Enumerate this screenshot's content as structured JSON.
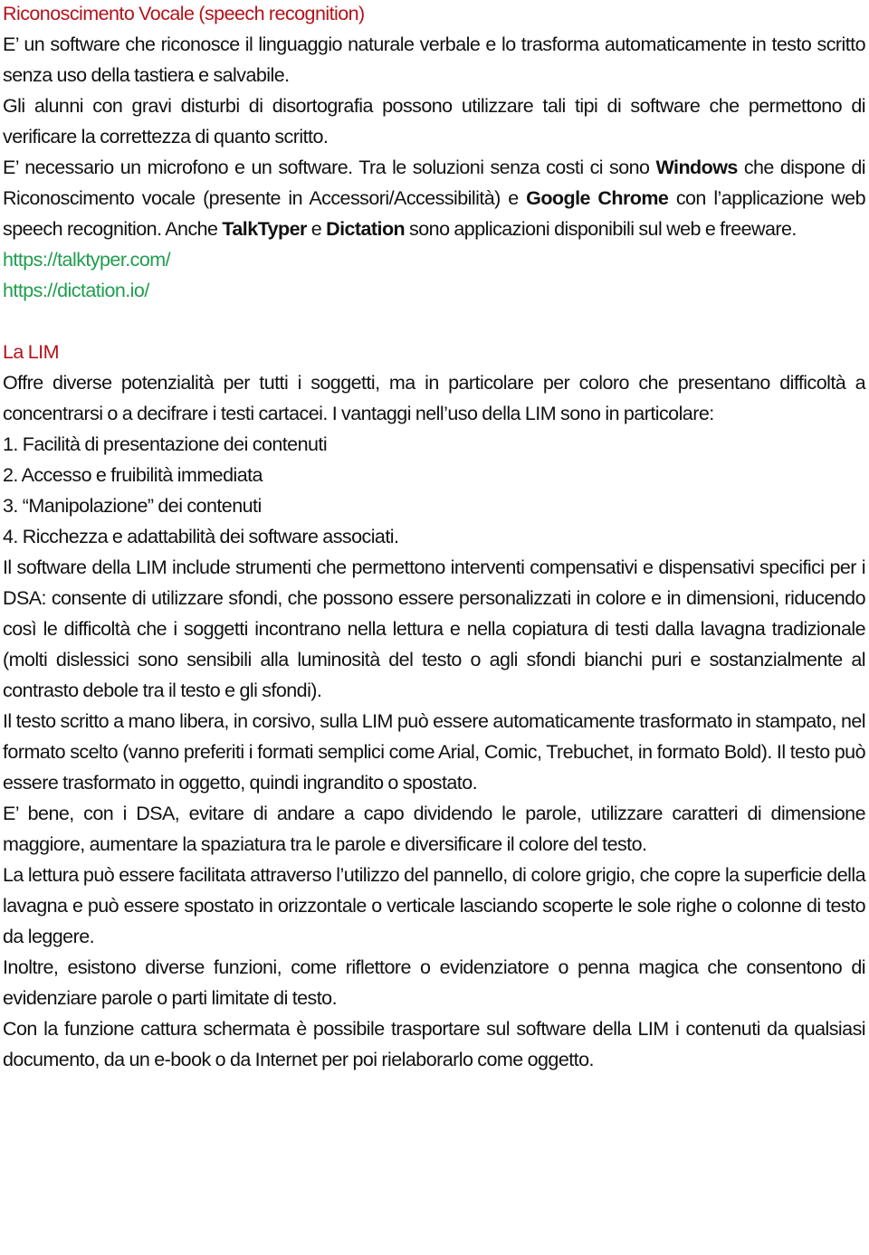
{
  "section1": {
    "heading": "Riconoscimento Vocale (speech recognition)",
    "p1": "E’ un software che riconosce il linguaggio naturale verbale e lo trasforma automaticamente in testo scritto senza uso della tastiera e salvabile.",
    "p2": "Gli alunni con gravi disturbi di disortografia possono utilizzare tali tipi di software che permettono di verificare la correttezza di quanto scritto.",
    "p3": {
      "t1": "E’ necessario un microfono e un software. Tra le soluzioni senza costi ci sono ",
      "b1": "Windows",
      "t2": " che dispone di Riconoscimento vocale (presente in Accessori/Accessibilità) e ",
      "b2": "Google Chrome",
      "t3": " con l’applicazione web speech recognition. Anche ",
      "b3": "TalkTyper",
      "t4": " e ",
      "b4": "Dictation",
      "t5": " sono applicazioni disponibili sul web e freeware."
    },
    "links": [
      "https://talktyper.com/",
      "https://dictation.io/"
    ]
  },
  "section2": {
    "heading": "La LIM",
    "p1": "Offre diverse potenzialità per tutti i soggetti, ma in particolare per coloro che presentano difficoltà a concentrarsi o a decifrare i testi cartacei. I vantaggi nell’uso della LIM sono in particolare:",
    "list": [
      "1. Facilità di presentazione dei contenuti",
      "2. Accesso e fruibilità immediata",
      "3. “Manipolazione” dei contenuti",
      "4. Ricchezza e adattabilità dei software associati."
    ],
    "p2": "Il software della LIM include strumenti che permettono interventi compensativi e dispensativi specifici per i DSA: consente di utilizzare sfondi, che possono essere personalizzati in colore e in dimensioni, riducendo così le difficoltà che i soggetti incontrano nella lettura e nella copiatura di testi dalla lavagna tradizionale (molti dislessici sono sensibili alla luminosità del testo o agli sfondi bianchi puri e sostanzialmente al contrasto debole tra il testo e gli sfondi).",
    "p3": "Il testo scritto a mano libera, in corsivo, sulla LIM può essere automaticamente trasformato in stampato, nel formato scelto (vanno preferiti i formati semplici come Arial, Comic, Trebuchet, in formato Bold). Il testo può essere trasformato in oggetto, quindi ingrandito o spostato.",
    "p4": "E’ bene, con i DSA, evitare di andare a capo dividendo le parole, utilizzare caratteri di dimensione maggiore, aumentare la spaziatura tra le parole e diversificare il colore del testo.",
    "p5": "La lettura può essere facilitata attraverso l’utilizzo del pannello, di colore grigio, che copre la superficie della lavagna e può essere spostato in orizzontale o verticale lasciando scoperte le sole righe o colonne di testo da leggere.",
    "p6": "Inoltre, esistono diverse funzioni, come riflettore o evidenziatore o penna magica che consentono di evidenziare parole o parti limitate di testo.",
    "p7": "Con la funzione cattura schermata è possibile trasportare sul software della LIM i contenuti da qualsiasi documento, da un e-book o da Internet per poi rielaborarlo come oggetto."
  },
  "colors": {
    "heading": "#b5121b",
    "link": "#1e9e4e",
    "text": "#111111"
  }
}
